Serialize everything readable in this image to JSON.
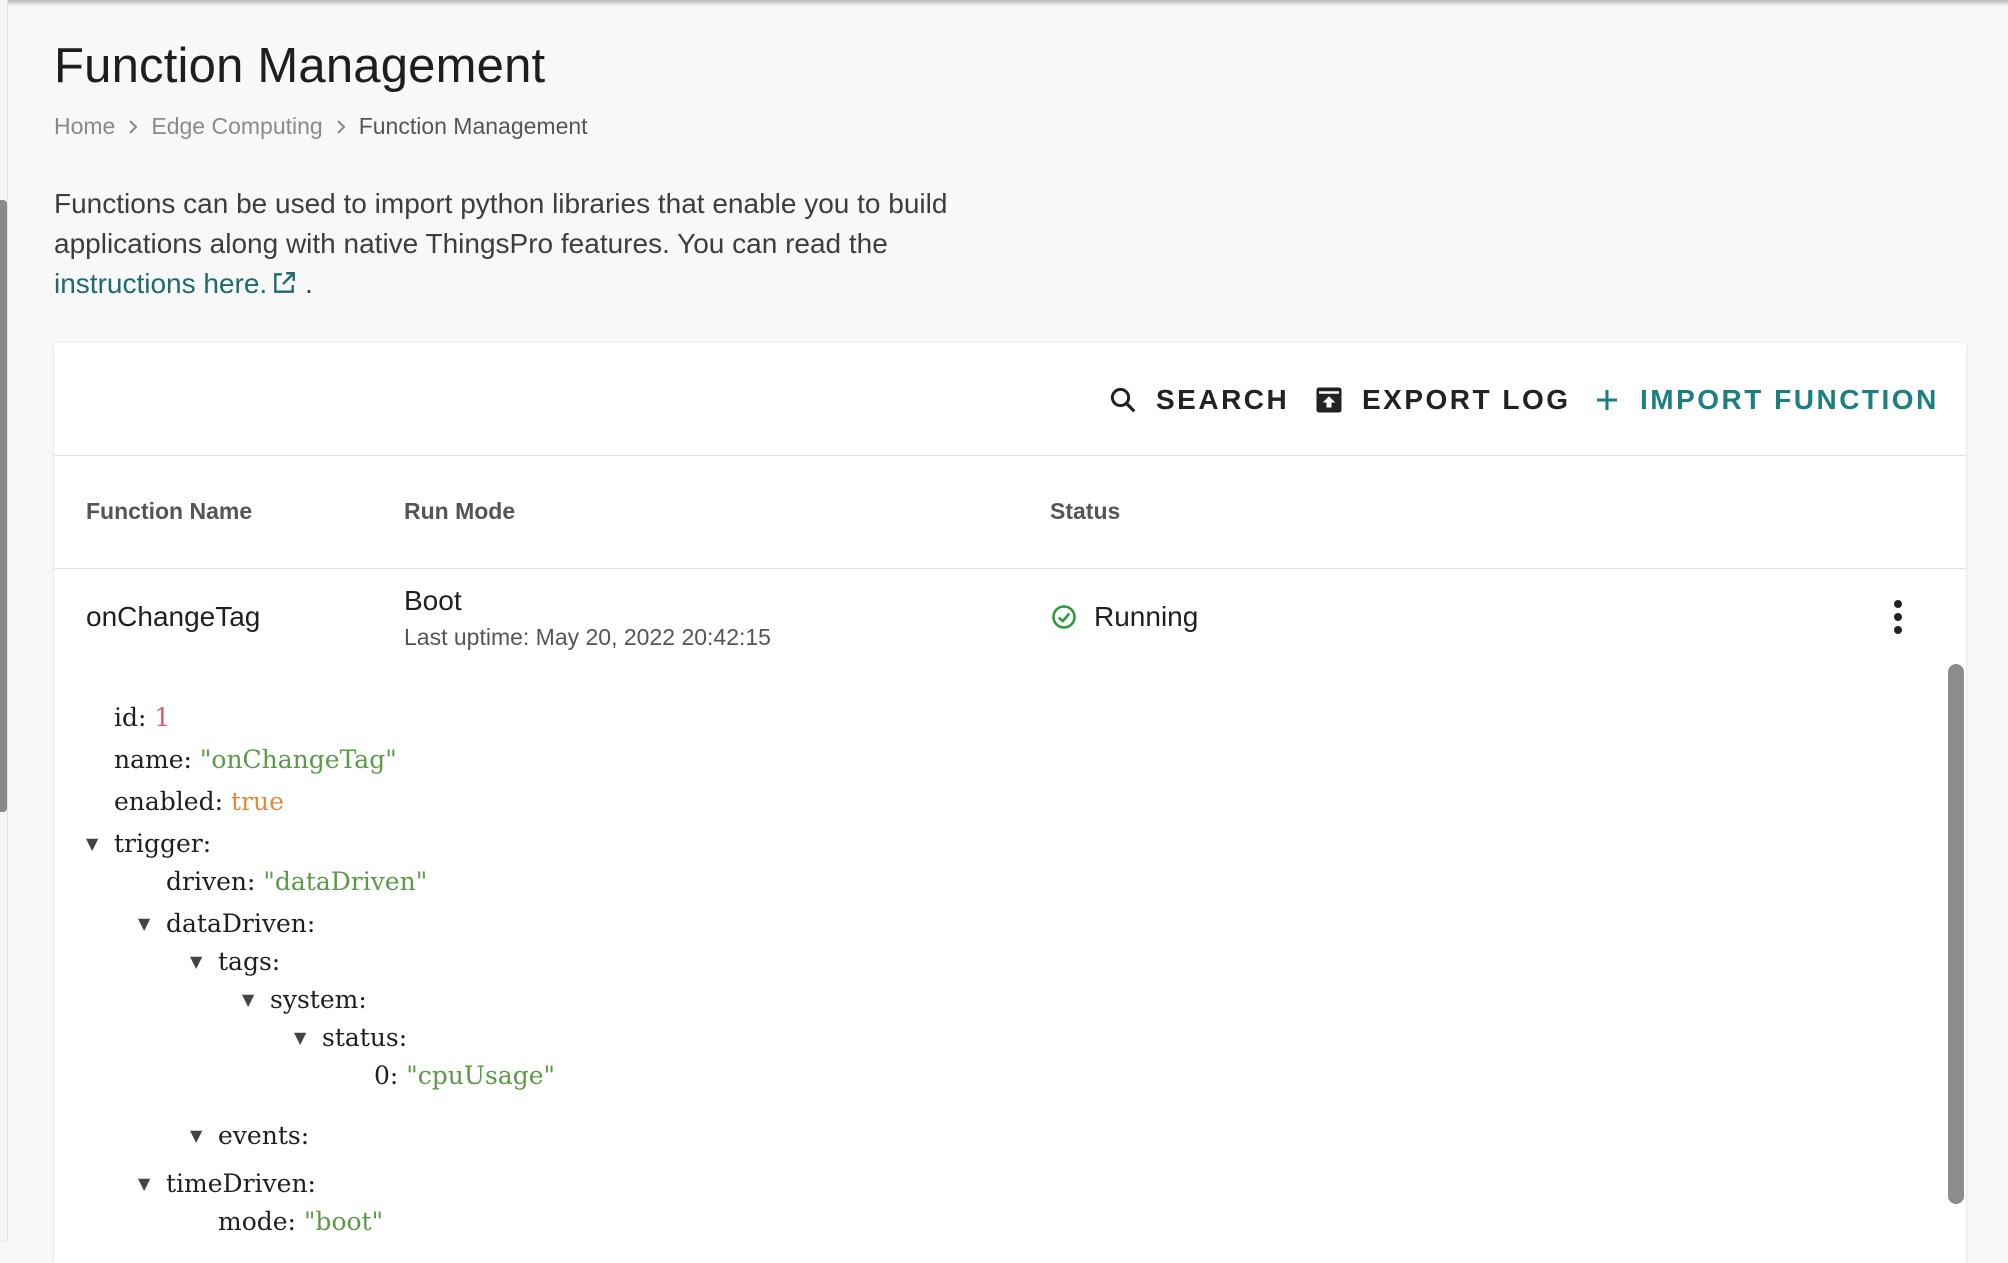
{
  "page": {
    "title": "Function Management",
    "breadcrumb": [
      "Home",
      "Edge Computing",
      "Function Management"
    ],
    "description": "Functions can be used to import python libraries that enable you to build applications along with native ThingsPro features. You can read the",
    "description_line1": "Functions can be used to import python libraries that enable you to build",
    "description_line2": "applications along with native ThingsPro features. You can read the",
    "link_text": "instructions here.",
    "link_suffix": " ."
  },
  "toolbar": {
    "search_label": "SEARCH",
    "export_label": "EXPORT LOG",
    "import_label": "IMPORT FUNCTION"
  },
  "table": {
    "columns": [
      "Function Name",
      "Run Mode",
      "Status"
    ],
    "rows": [
      {
        "name": "onChangeTag",
        "run_mode": "Boot",
        "uptime": "Last uptime: May 20, 2022 20:42:15",
        "status": "Running"
      }
    ]
  },
  "detail": {
    "id_key": "id:",
    "id_val": "1",
    "name_key": "name:",
    "name_val": "\"onChangeTag\"",
    "enabled_key": "enabled:",
    "enabled_val": "true",
    "trigger_key": "trigger:",
    "driven_key": "driven:",
    "driven_val": "\"dataDriven\"",
    "datadriven_key": "dataDriven:",
    "tags_key": "tags:",
    "system_key": "system:",
    "status_key": "status:",
    "zero_key": "0:",
    "zero_val": "\"cpuUsage\"",
    "events_key": "events:",
    "timedriven_key": "timeDriven:",
    "mode_key": "mode:",
    "mode_val": "\"boot\""
  },
  "colors": {
    "accent": "#1d8080",
    "link": "#1d6b6b",
    "success": "#2e9a3e",
    "json_number": "#e05a5a",
    "json_string": "#5b9a46",
    "json_bool": "#e08a3a"
  }
}
